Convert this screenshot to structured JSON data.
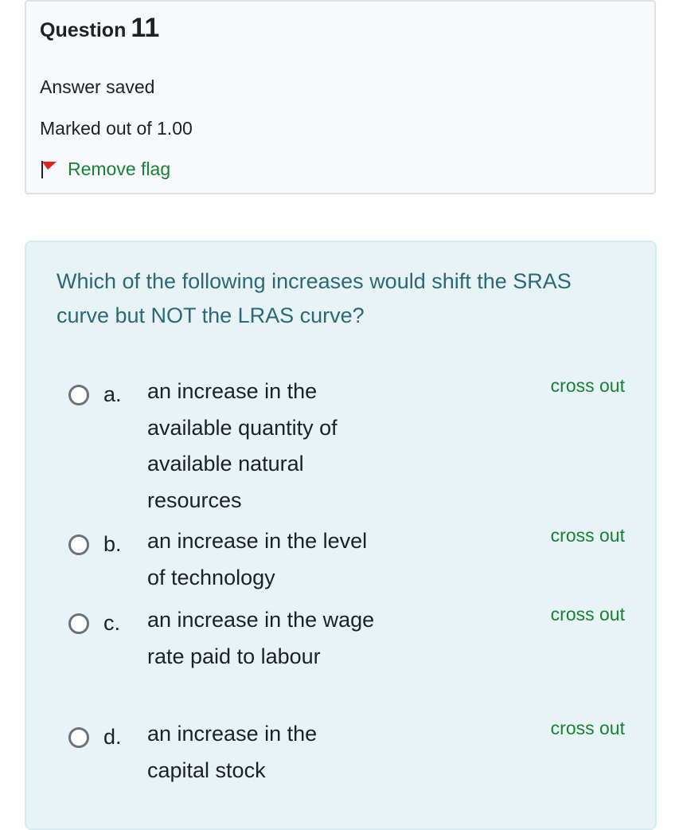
{
  "info": {
    "question_word": "Question",
    "question_number": "11",
    "state": "Answer saved",
    "grade": "Marked out of 1.00",
    "flag_label": "Remove flag",
    "flag_icon": "red-flag-icon",
    "flag_color": "#e02424",
    "link_color": "#188038"
  },
  "question": {
    "text": "Which of the following increases would shift the SRAS curve but NOT the LRAS curve?",
    "text_color": "#2c6878",
    "background": "#e7f3f5"
  },
  "options": [
    {
      "letter": "a.",
      "text": "an increase in the available quantity of available natural resources",
      "cross_out": "cross out",
      "selected": false
    },
    {
      "letter": "b.",
      "text": "an increase in the level of technology",
      "cross_out": "cross out",
      "selected": false
    },
    {
      "letter": "c.",
      "text": "an increase in the wage rate paid to labour",
      "cross_out": "cross out",
      "selected": false
    },
    {
      "letter": "d.",
      "text": "an increase in the capital stock",
      "cross_out": "cross out",
      "selected": false
    }
  ]
}
